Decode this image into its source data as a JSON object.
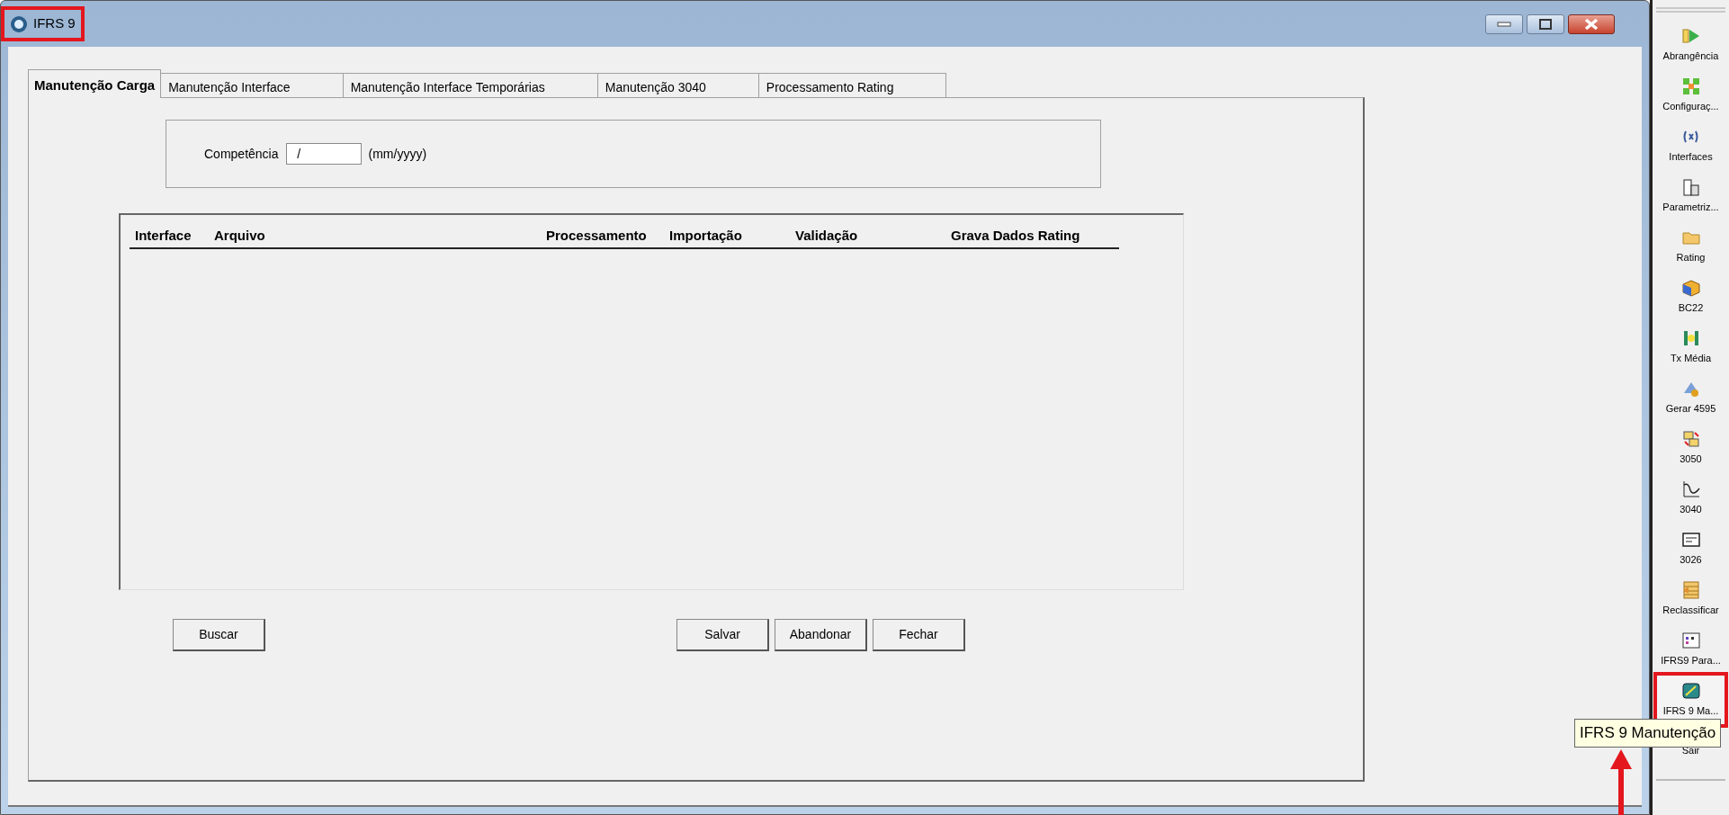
{
  "window": {
    "title": "IFRS 9",
    "highlighted": true
  },
  "tabs": [
    {
      "label": "Manutenção Carga",
      "selected": true
    },
    {
      "label": "Manutenção Interface",
      "selected": false
    },
    {
      "label": "Manutenção Interface Temporárias",
      "selected": false
    },
    {
      "label": "Manutenção 3040",
      "selected": false
    },
    {
      "label": "Processamento Rating",
      "selected": false
    }
  ],
  "competencia": {
    "label": "Competência",
    "value": "  /",
    "hint": "(mm/yyyy)"
  },
  "table": {
    "columns": [
      "Interface",
      "Arquivo",
      "Processamento",
      "Importação",
      "Validação",
      "Grava Dados Rating"
    ]
  },
  "buttons_left": [
    "Buscar"
  ],
  "buttons_right": [
    "Salvar",
    "Abandonar",
    "Fechar"
  ],
  "sidebar": {
    "items": [
      {
        "label": "Abrangência",
        "highlighted": false
      },
      {
        "label": "Configuraç...",
        "highlighted": false
      },
      {
        "label": "Interfaces",
        "highlighted": false
      },
      {
        "label": "Parametriz...",
        "highlighted": false
      },
      {
        "label": "Rating",
        "highlighted": false
      },
      {
        "label": "BC22",
        "highlighted": false
      },
      {
        "label": "Tx Média",
        "highlighted": false
      },
      {
        "label": "Gerar 4595",
        "highlighted": false
      },
      {
        "label": "3050",
        "highlighted": false
      },
      {
        "label": "3040",
        "highlighted": false
      },
      {
        "label": "3026",
        "highlighted": false
      },
      {
        "label": "Reclassificar",
        "highlighted": false
      },
      {
        "label": "IFRS9 Para...",
        "highlighted": false
      },
      {
        "label": "IFRS 9 Ma...",
        "highlighted": true
      },
      {
        "label": "Sair",
        "highlighted": false
      }
    ]
  },
  "tooltip": {
    "text": "IFRS 9 Manutenção",
    "arrow": true
  }
}
